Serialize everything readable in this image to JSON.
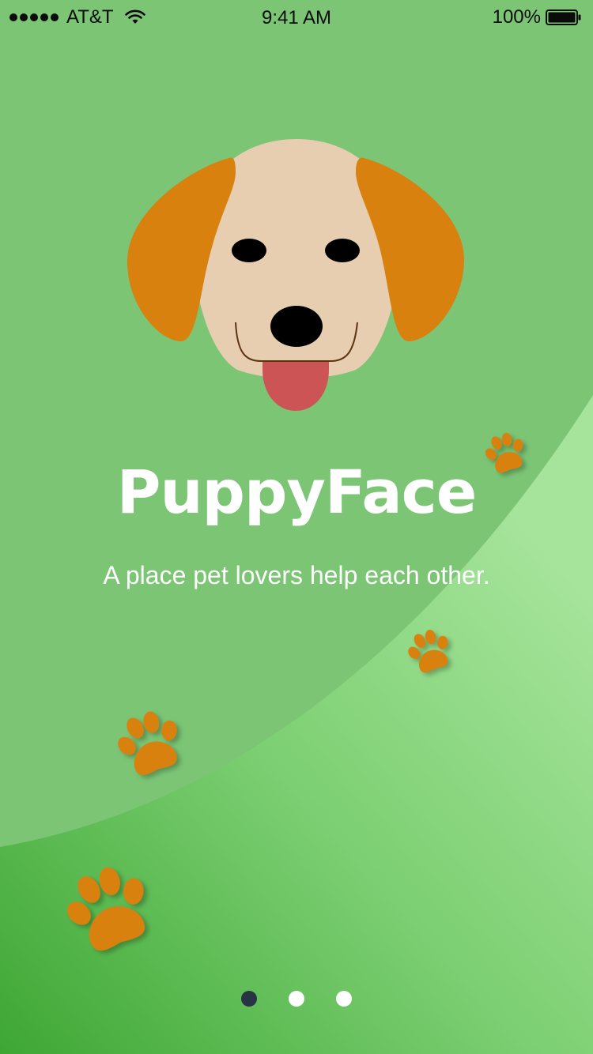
{
  "status_bar": {
    "carrier": "AT&T",
    "time": "9:41 AM",
    "battery": "100%",
    "icons": [
      "signal-dots-icon",
      "wifi-icon",
      "battery-icon"
    ]
  },
  "hero": {
    "illustration": "puppy-face-icon",
    "title": "PuppyFace",
    "tagline": "A place pet lovers help each other."
  },
  "decorations": {
    "icon": "paw-print-icon",
    "color": "#d8810f"
  },
  "pager": {
    "pages": 3,
    "active_index": 0
  },
  "colors": {
    "background": "#7bc575",
    "background_light": "#a5e39a",
    "background_dark": "#3ea734",
    "ear": "#d8810f",
    "face": "#e8ceb0",
    "tongue": "#cd5454",
    "pager_active": "#283344",
    "pager_inactive": "#ffffff"
  }
}
